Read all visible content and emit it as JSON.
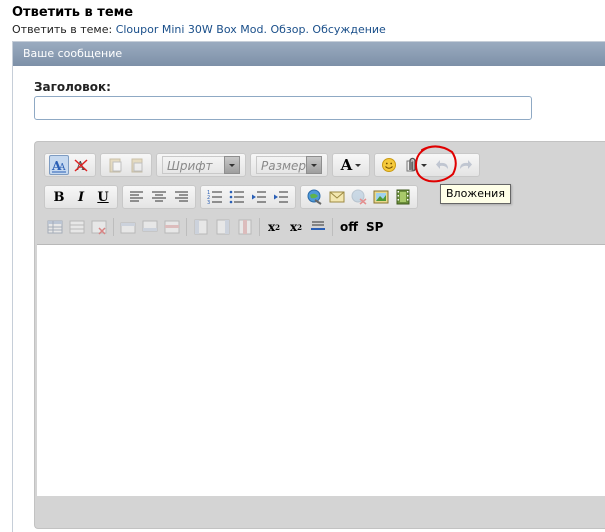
{
  "header": {
    "title": "Ответить в теме",
    "subtitle_prefix": "Ответить в теме: ",
    "thread_link": "Cloupor Mini 30W Box Mod. Обзор. Обсуждение"
  },
  "panel": {
    "title": "Ваше сообщение",
    "heading_label": "Заголовок:",
    "heading_value": ""
  },
  "toolbar": {
    "font_combo": "Шрифт",
    "size_combo": "Размер",
    "font_color_label": "A",
    "bold": "B",
    "italic": "I",
    "underline": "U",
    "subscript": "x",
    "subscript_mark": "2",
    "superscript": "x",
    "superscript_mark": "2",
    "off_label": "off",
    "sp_label": "SP",
    "attachments_tooltip": "Вложения"
  },
  "colors": {
    "link": "#1a4f8a",
    "panel_header": "#8a9cb3",
    "annotation": "#e00000"
  }
}
